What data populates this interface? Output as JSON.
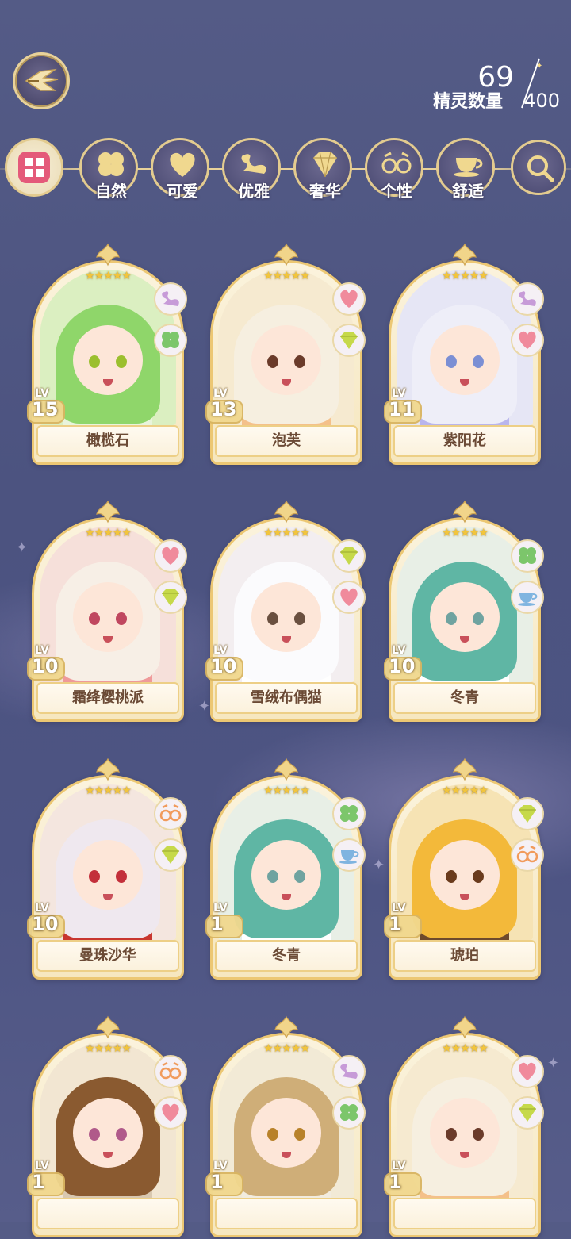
{
  "header": {
    "back_icon": "winged-back-arrow-icon",
    "count_current": "69",
    "count_total": "400",
    "count_label": "精灵数量"
  },
  "filters": [
    {
      "label": "",
      "icon": "grid-icon",
      "selected": true
    },
    {
      "label": "自然",
      "icon": "clover-icon"
    },
    {
      "label": "可爱",
      "icon": "heart-icon"
    },
    {
      "label": "优雅",
      "icon": "swan-icon"
    },
    {
      "label": "奢华",
      "icon": "diamond-icon"
    },
    {
      "label": "个性",
      "icon": "glasses-icon"
    },
    {
      "label": "舒适",
      "icon": "teacup-icon"
    },
    {
      "label": "",
      "icon": "search-icon"
    }
  ],
  "cards": [
    {
      "name": "橄榄石",
      "lv_label": "LV",
      "level": "15",
      "stars": 5,
      "tags": [
        "swan-icon",
        "clover-icon"
      ],
      "hair": "#8fd66a",
      "eyes": "#9bbf2e",
      "outfit": "#e9f4dc",
      "bg": "#dbefc1"
    },
    {
      "name": "泡芙",
      "lv_label": "LV",
      "level": "13",
      "stars": 5,
      "tags": [
        "heart-icon",
        "diamond-icon"
      ],
      "hair": "#f6efe0",
      "eyes": "#6b3b2a",
      "outfit": "#f4c08a",
      "bg": "#f6ead0"
    },
    {
      "name": "紫阳花",
      "lv_label": "LV",
      "level": "11",
      "stars": 5,
      "tags": [
        "swan-icon",
        "heart-icon"
      ],
      "hair": "#eeeef8",
      "eyes": "#7b8fd4",
      "outfit": "#b9b5ec",
      "bg": "#e6e6f5"
    },
    {
      "name": "霜绛樱桃派",
      "lv_label": "LV",
      "level": "10",
      "stars": 5,
      "tags": [
        "heart-icon",
        "diamond-icon"
      ],
      "hair": "#f7efe6",
      "eyes": "#c0475f",
      "outfit": "#ef9a9a",
      "bg": "#f6e0da"
    },
    {
      "name": "雪绒布偶猫",
      "lv_label": "LV",
      "level": "10",
      "stars": 5,
      "tags": [
        "diamond-icon",
        "heart-icon"
      ],
      "hair": "#fbfbfd",
      "eyes": "#6a5040",
      "outfit": "#ffffff",
      "bg": "#f3eef0"
    },
    {
      "name": "冬青",
      "lv_label": "LV",
      "level": "10",
      "stars": 5,
      "tags": [
        "clover-icon",
        "teacup-icon"
      ],
      "hair": "#5fb6a4",
      "eyes": "#6fa3a0",
      "outfit": "#ffffff",
      "bg": "#e8efe6"
    },
    {
      "name": "曼珠沙华",
      "lv_label": "LV",
      "level": "10",
      "stars": 5,
      "tags": [
        "glasses-icon",
        "diamond-icon"
      ],
      "hair": "#efe8ef",
      "eyes": "#c32f3a",
      "outfit": "#c8362f",
      "bg": "#f4e6df"
    },
    {
      "name": "冬青",
      "lv_label": "LV",
      "level": "1",
      "stars": 5,
      "tags": [
        "clover-icon",
        "teacup-icon"
      ],
      "hair": "#5fb6a4",
      "eyes": "#6fa3a0",
      "outfit": "#ffffff",
      "bg": "#e8efe6"
    },
    {
      "name": "琥珀",
      "lv_label": "LV",
      "level": "1",
      "stars": 5,
      "tags": [
        "diamond-icon",
        "glasses-icon"
      ],
      "hair": "#f3b93a",
      "eyes": "#6a3b1c",
      "outfit": "#6e4a2c",
      "bg": "#f6e3b4"
    },
    {
      "name": "",
      "lv_label": "LV",
      "level": "1",
      "stars": 5,
      "tags": [
        "glasses-icon",
        "heart-icon"
      ],
      "hair": "#8a5a30",
      "eyes": "#b05a8a",
      "outfit": "#d9c8b0",
      "bg": "#f2e6d2"
    },
    {
      "name": "",
      "lv_label": "LV",
      "level": "1",
      "stars": 5,
      "tags": [
        "swan-icon",
        "clover-icon"
      ],
      "hair": "#cfae78",
      "eyes": "#b8822a",
      "outfit": "#f2ecdf",
      "bg": "#f2ead6"
    },
    {
      "name": "",
      "lv_label": "LV",
      "level": "1",
      "stars": 5,
      "tags": [
        "heart-icon",
        "diamond-icon"
      ],
      "hair": "#f6efe0",
      "eyes": "#6b3b2a",
      "outfit": "#f4c08a",
      "bg": "#f6ead0"
    }
  ],
  "colors": {
    "accent_gold": "#e8d29a",
    "tag_pink": "#f08a9c",
    "tag_purple": "#c79bd8",
    "tag_green": "#7cc66b",
    "tag_yellow_green": "#c6d94a",
    "tag_orange": "#f19b5c",
    "tag_blue": "#7fb4e0"
  }
}
